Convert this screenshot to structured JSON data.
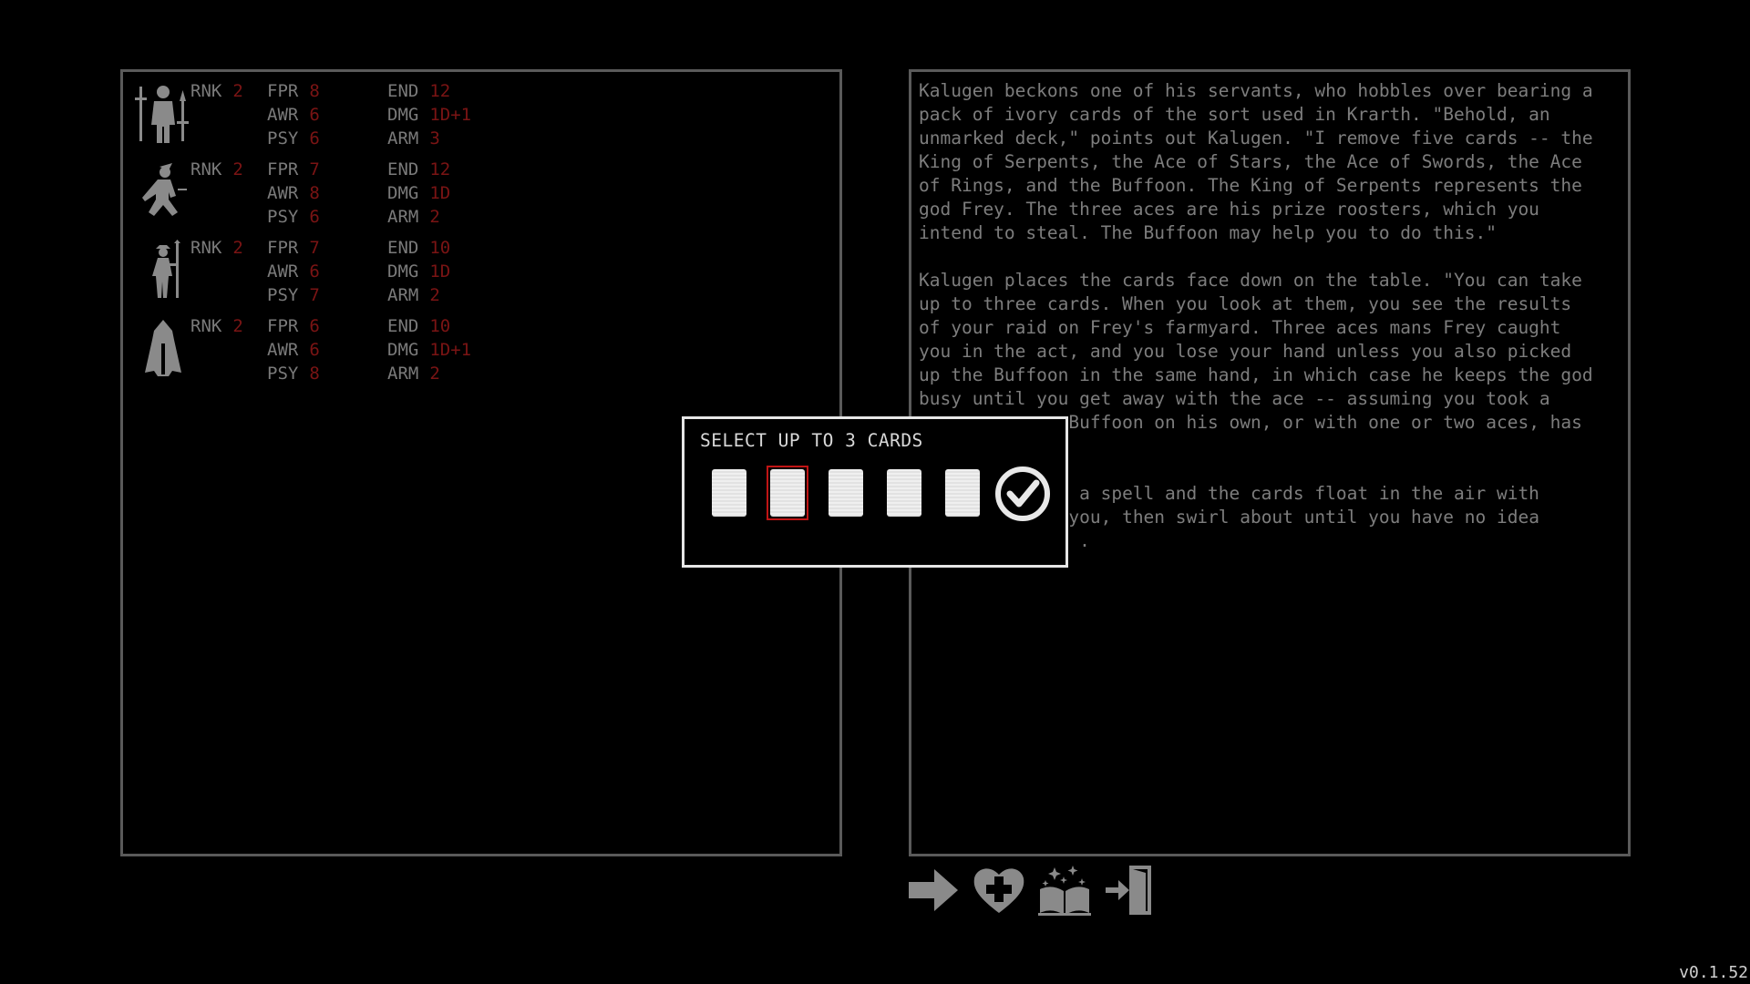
{
  "party": [
    {
      "portrait_icon": "warrior-icon",
      "rnk": "2",
      "fpr": "8",
      "awr": "6",
      "psy": "6",
      "end": "12",
      "dmg": "1D+1",
      "arm": "3"
    },
    {
      "portrait_icon": "trickster-icon",
      "rnk": "2",
      "fpr": "7",
      "awr": "8",
      "psy": "6",
      "end": "12",
      "dmg": "1D",
      "arm": "2"
    },
    {
      "portrait_icon": "sage-icon",
      "rnk": "2",
      "fpr": "7",
      "awr": "6",
      "psy": "7",
      "end": "10",
      "dmg": "1D",
      "arm": "2"
    },
    {
      "portrait_icon": "enchanter-icon",
      "rnk": "2",
      "fpr": "6",
      "awr": "6",
      "psy": "8",
      "end": "10",
      "dmg": "1D+1",
      "arm": "2"
    }
  ],
  "labels": {
    "rnk": "RNK",
    "fpr": "FPR",
    "awr": "AWR",
    "psy": "PSY",
    "end": "END",
    "dmg": "DMG",
    "arm": "ARM"
  },
  "story": {
    "text": "Kalugen beckons one of his servants, who hobbles over bearing a\npack of ivory cards of the sort used in Krarth. \"Behold, an\nunmarked deck,\" points out Kalugen. \"I remove five cards -- the\nKing of Serpents, the Ace of Stars, the Ace of Swords, the Ace\nof Rings, and the Buffoon. The King of Serpents represents the\ngod Frey. The three aces are his prize roosters, which you\nintend to steal. The Buffoon may help you to do this.\"\n\nKalugen places the cards face down on the table. \"You can take\nup to three cards. When you look at them, you see the results\nof your raid on Frey's farmyard. Three aces mans Frey caught\nyou in the act, and you lose your hand unless you also picked\nup the Buffoon in the same hand, in which case he keeps the god\nbusy until you get away with the ace -- assuming you took a\n              Buffoon on his own, or with one or two aces, has\n\n\n             s a spell and the cards float in the air with\n              you, then swirl about until you have no idea\n               ."
  },
  "dialog": {
    "title": "SELECT UP TO 3 CARDS",
    "cards": [
      {
        "selected": false
      },
      {
        "selected": true
      },
      {
        "selected": false
      },
      {
        "selected": false
      },
      {
        "selected": false
      }
    ],
    "confirm_icon": "checkmark-icon"
  },
  "toolbar": {
    "buttons": [
      "continue-arrow-icon",
      "heal-heart-icon",
      "spellbook-icon",
      "exit-door-icon"
    ]
  },
  "version": "v0.1.52",
  "colors": {
    "background": "#000000",
    "panel_border": "#5a5a5a",
    "stat_label": "#7a7a7a",
    "stat_value": "#7a1414",
    "selected_card_border": "#c01414",
    "dialog_border": "#e6e6e6"
  }
}
